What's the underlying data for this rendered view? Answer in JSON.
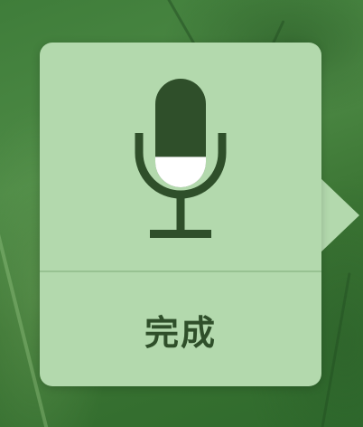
{
  "dictation_popover": {
    "icon": "microphone-icon",
    "input_level": 0.28,
    "done_label": "完成"
  },
  "colors": {
    "popover_background": "#b3d9ad",
    "icon_color": "#2f4f2a",
    "level_fill": "#ffffff",
    "desktop_background": "#3f7d3a"
  }
}
